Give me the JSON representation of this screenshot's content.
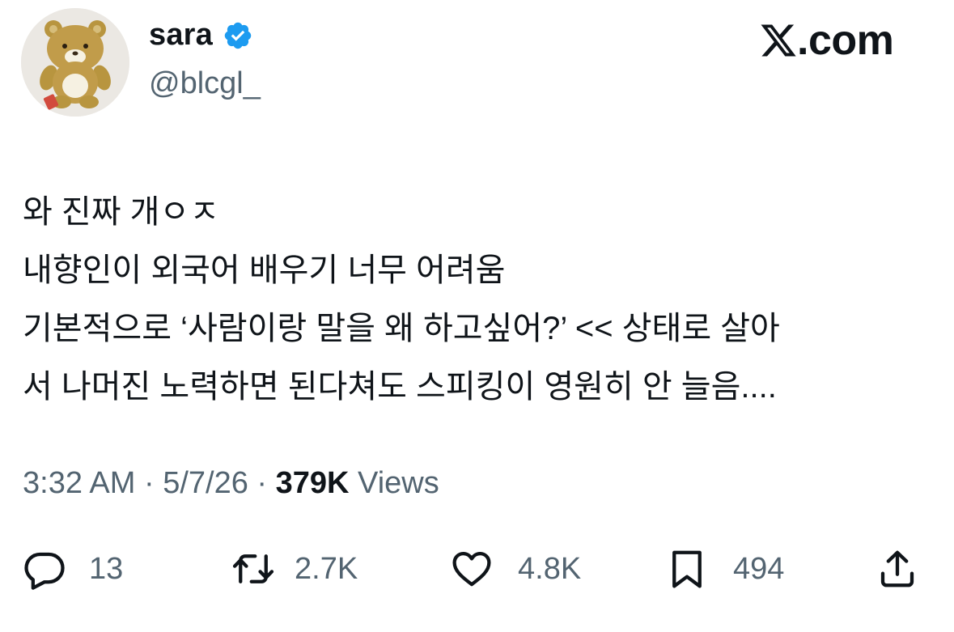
{
  "author": {
    "display_name": "sara",
    "handle": "@blcgl_",
    "verified": true,
    "avatar": "plush-bear-avatar"
  },
  "site": {
    "logo_icon": "x-logo-icon",
    "logo_text": ".com"
  },
  "tweet": {
    "lines": [
      "와 진짜 개ㅇㅈ",
      "내향인이 외국어 배우기 너무 어려움",
      "기본적으로 ‘사람이랑 말을 왜 하고싶어?’ << 상태로 살아",
      "서 나머진 노력하면 된다쳐도 스피킹이 영원히 안 늘음...."
    ]
  },
  "meta": {
    "time": "3:32 AM",
    "separator": "·",
    "date": "5/7/26",
    "views_count": "379K",
    "views_label": "Views"
  },
  "actions": {
    "reply": {
      "icon": "reply-icon",
      "count": "13"
    },
    "retweet": {
      "icon": "retweet-icon",
      "count": "2.7K"
    },
    "like": {
      "icon": "heart-icon",
      "count": "4.8K"
    },
    "bookmark": {
      "icon": "bookmark-icon",
      "count": "494"
    },
    "share": {
      "icon": "share-icon"
    }
  },
  "colors": {
    "text_primary": "#0f1419",
    "text_secondary": "#536471",
    "verified_badge": "#1d9bf0",
    "background": "#ffffff"
  }
}
